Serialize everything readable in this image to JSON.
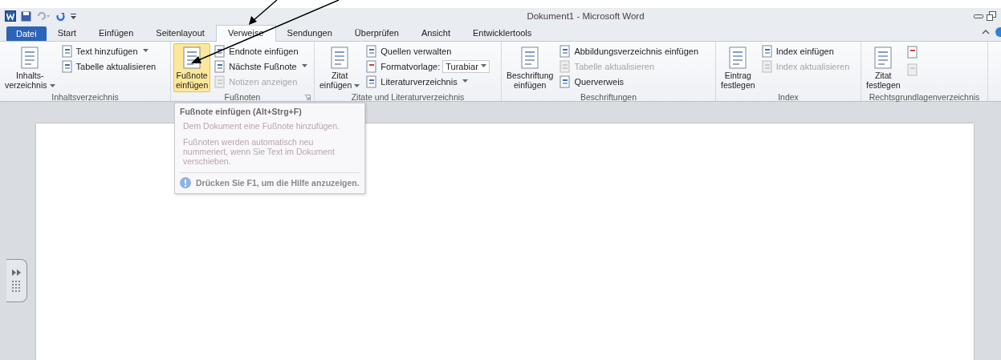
{
  "window": {
    "title": "Dokument1  -  Microsoft Word"
  },
  "tabs": [
    {
      "label": "Datei",
      "selected": false,
      "kind": "file"
    },
    {
      "label": "Start",
      "selected": false,
      "kind": "tab"
    },
    {
      "label": "Einfügen",
      "selected": false,
      "kind": "tab"
    },
    {
      "label": "Seitenlayout",
      "selected": false,
      "kind": "tab"
    },
    {
      "label": "Verweise",
      "selected": true,
      "kind": "tab"
    },
    {
      "label": "Sendungen",
      "selected": false,
      "kind": "tab"
    },
    {
      "label": "Überprüfen",
      "selected": false,
      "kind": "tab"
    },
    {
      "label": "Ansicht",
      "selected": false,
      "kind": "tab"
    },
    {
      "label": "Entwicklertools",
      "selected": false,
      "kind": "tab"
    }
  ],
  "groups": [
    {
      "label": "Inhaltsverzeichnis",
      "launcher": false,
      "items": [
        {
          "kind": "large",
          "label": "Inhalts-\nverzeichnis",
          "dropdown": true,
          "highlighted": false,
          "disabled": false
        },
        {
          "kind": "column",
          "rows": [
            {
              "label": "Text hinzufügen",
              "dropdown": true,
              "disabled": false
            },
            {
              "label": "Tabelle aktualisieren",
              "dropdown": false,
              "disabled": false
            }
          ]
        }
      ]
    },
    {
      "label": "Fußnoten",
      "launcher": true,
      "items": [
        {
          "kind": "large",
          "label": "Fußnote\neinfügen",
          "dropdown": false,
          "highlighted": true,
          "disabled": false
        },
        {
          "kind": "column",
          "rows": [
            {
              "label": "Endnote einfügen",
              "dropdown": false,
              "disabled": false
            },
            {
              "label": "Nächste Fußnote",
              "dropdown": true,
              "disabled": false
            },
            {
              "label": "Notizen anzeigen",
              "dropdown": false,
              "disabled": true
            }
          ]
        }
      ]
    },
    {
      "label": "Zitate und Literaturverzeichnis",
      "launcher": false,
      "items": [
        {
          "kind": "large",
          "label": "Zitat\neinfügen",
          "dropdown": true,
          "highlighted": false,
          "disabled": false
        },
        {
          "kind": "column",
          "rows": [
            {
              "label": "Quellen verwalten",
              "dropdown": false,
              "disabled": false
            },
            {
              "label": "Formatvorlage:",
              "disabled": false,
              "value": "Turabiar"
            },
            {
              "label": "Literaturverzeichnis",
              "dropdown": true,
              "disabled": false
            }
          ]
        }
      ]
    },
    {
      "label": "Beschriftungen",
      "launcher": false,
      "items": [
        {
          "kind": "large",
          "label": "Beschriftung\neinfügen",
          "dropdown": false,
          "highlighted": false,
          "disabled": false
        },
        {
          "kind": "column",
          "rows": [
            {
              "label": "Abbildungsverzeichnis einfügen",
              "dropdown": false,
              "disabled": false
            },
            {
              "label": "Tabelle aktualisieren",
              "dropdown": false,
              "disabled": true
            },
            {
              "label": "Querverweis",
              "dropdown": false,
              "disabled": false
            }
          ]
        }
      ]
    },
    {
      "label": "Index",
      "launcher": false,
      "items": [
        {
          "kind": "large",
          "label": "Eintrag\nfestlegen",
          "dropdown": false,
          "highlighted": false,
          "disabled": false
        },
        {
          "kind": "column",
          "rows": [
            {
              "label": "Index einfügen",
              "dropdown": false,
              "disabled": false
            },
            {
              "label": "Index aktualisieren",
              "dropdown": false,
              "disabled": true
            }
          ]
        }
      ]
    },
    {
      "label": "Rechtsgrundlagenverzeichnis",
      "launcher": false,
      "items": [
        {
          "kind": "large",
          "label": "Zitat\nfestlegen",
          "dropdown": false,
          "highlighted": false,
          "disabled": false
        },
        {
          "kind": "column",
          "rows": [
            {
              "disabled": false
            },
            {
              "disabled": true
            }
          ]
        }
      ]
    }
  ],
  "tooltip": {
    "title": "Fußnote einfügen (Alt+Strg+F)",
    "paragraphs": [
      "Dem Dokument eine Fußnote hinzufügen.",
      "Fußnoten werden automatisch neu nummeriert, wenn Sie Text im Dokument verschieben."
    ],
    "help": "Drücken Sie F1, um die Hilfe anzuzeigen."
  }
}
